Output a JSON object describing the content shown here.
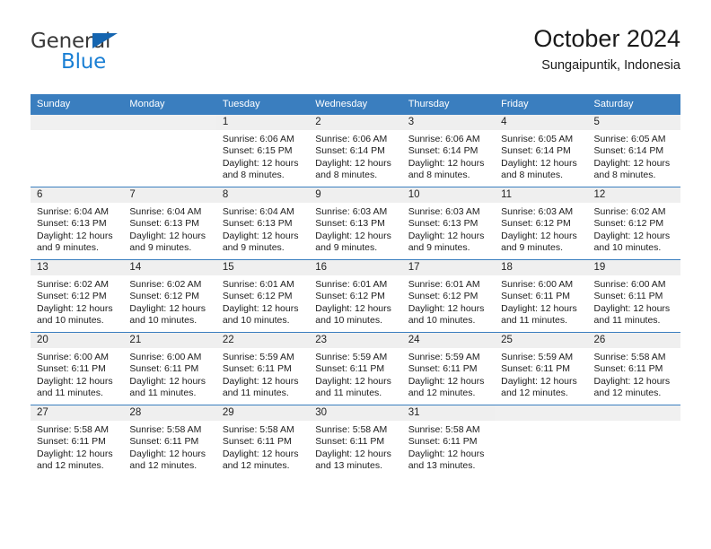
{
  "brand": {
    "name_top": "General",
    "name_bottom": "Blue",
    "accent_color": "#1a7fd4",
    "triangle_color": "#1565b0"
  },
  "header": {
    "title": "October 2024",
    "subtitle": "Sungaipuntik, Indonesia"
  },
  "theme": {
    "header_row_bg": "#3a7ebf",
    "daynum_bg": "#efefef",
    "row_divider": "#3a7ebf"
  },
  "weekdays": [
    "Sunday",
    "Monday",
    "Tuesday",
    "Wednesday",
    "Thursday",
    "Friday",
    "Saturday"
  ],
  "labels": {
    "sunrise_prefix": "Sunrise:",
    "sunset_prefix": "Sunset:",
    "daylight_prefix": "Daylight:"
  },
  "weeks": [
    [
      {
        "day": "",
        "lines": []
      },
      {
        "day": "",
        "lines": []
      },
      {
        "day": "1",
        "lines": [
          "Sunrise: 6:06 AM",
          "Sunset: 6:15 PM",
          "Daylight: 12 hours",
          "and 8 minutes."
        ]
      },
      {
        "day": "2",
        "lines": [
          "Sunrise: 6:06 AM",
          "Sunset: 6:14 PM",
          "Daylight: 12 hours",
          "and 8 minutes."
        ]
      },
      {
        "day": "3",
        "lines": [
          "Sunrise: 6:06 AM",
          "Sunset: 6:14 PM",
          "Daylight: 12 hours",
          "and 8 minutes."
        ]
      },
      {
        "day": "4",
        "lines": [
          "Sunrise: 6:05 AM",
          "Sunset: 6:14 PM",
          "Daylight: 12 hours",
          "and 8 minutes."
        ]
      },
      {
        "day": "5",
        "lines": [
          "Sunrise: 6:05 AM",
          "Sunset: 6:14 PM",
          "Daylight: 12 hours",
          "and 8 minutes."
        ]
      }
    ],
    [
      {
        "day": "6",
        "lines": [
          "Sunrise: 6:04 AM",
          "Sunset: 6:13 PM",
          "Daylight: 12 hours",
          "and 9 minutes."
        ]
      },
      {
        "day": "7",
        "lines": [
          "Sunrise: 6:04 AM",
          "Sunset: 6:13 PM",
          "Daylight: 12 hours",
          "and 9 minutes."
        ]
      },
      {
        "day": "8",
        "lines": [
          "Sunrise: 6:04 AM",
          "Sunset: 6:13 PM",
          "Daylight: 12 hours",
          "and 9 minutes."
        ]
      },
      {
        "day": "9",
        "lines": [
          "Sunrise: 6:03 AM",
          "Sunset: 6:13 PM",
          "Daylight: 12 hours",
          "and 9 minutes."
        ]
      },
      {
        "day": "10",
        "lines": [
          "Sunrise: 6:03 AM",
          "Sunset: 6:13 PM",
          "Daylight: 12 hours",
          "and 9 minutes."
        ]
      },
      {
        "day": "11",
        "lines": [
          "Sunrise: 6:03 AM",
          "Sunset: 6:12 PM",
          "Daylight: 12 hours",
          "and 9 minutes."
        ]
      },
      {
        "day": "12",
        "lines": [
          "Sunrise: 6:02 AM",
          "Sunset: 6:12 PM",
          "Daylight: 12 hours",
          "and 10 minutes."
        ]
      }
    ],
    [
      {
        "day": "13",
        "lines": [
          "Sunrise: 6:02 AM",
          "Sunset: 6:12 PM",
          "Daylight: 12 hours",
          "and 10 minutes."
        ]
      },
      {
        "day": "14",
        "lines": [
          "Sunrise: 6:02 AM",
          "Sunset: 6:12 PM",
          "Daylight: 12 hours",
          "and 10 minutes."
        ]
      },
      {
        "day": "15",
        "lines": [
          "Sunrise: 6:01 AM",
          "Sunset: 6:12 PM",
          "Daylight: 12 hours",
          "and 10 minutes."
        ]
      },
      {
        "day": "16",
        "lines": [
          "Sunrise: 6:01 AM",
          "Sunset: 6:12 PM",
          "Daylight: 12 hours",
          "and 10 minutes."
        ]
      },
      {
        "day": "17",
        "lines": [
          "Sunrise: 6:01 AM",
          "Sunset: 6:12 PM",
          "Daylight: 12 hours",
          "and 10 minutes."
        ]
      },
      {
        "day": "18",
        "lines": [
          "Sunrise: 6:00 AM",
          "Sunset: 6:11 PM",
          "Daylight: 12 hours",
          "and 11 minutes."
        ]
      },
      {
        "day": "19",
        "lines": [
          "Sunrise: 6:00 AM",
          "Sunset: 6:11 PM",
          "Daylight: 12 hours",
          "and 11 minutes."
        ]
      }
    ],
    [
      {
        "day": "20",
        "lines": [
          "Sunrise: 6:00 AM",
          "Sunset: 6:11 PM",
          "Daylight: 12 hours",
          "and 11 minutes."
        ]
      },
      {
        "day": "21",
        "lines": [
          "Sunrise: 6:00 AM",
          "Sunset: 6:11 PM",
          "Daylight: 12 hours",
          "and 11 minutes."
        ]
      },
      {
        "day": "22",
        "lines": [
          "Sunrise: 5:59 AM",
          "Sunset: 6:11 PM",
          "Daylight: 12 hours",
          "and 11 minutes."
        ]
      },
      {
        "day": "23",
        "lines": [
          "Sunrise: 5:59 AM",
          "Sunset: 6:11 PM",
          "Daylight: 12 hours",
          "and 11 minutes."
        ]
      },
      {
        "day": "24",
        "lines": [
          "Sunrise: 5:59 AM",
          "Sunset: 6:11 PM",
          "Daylight: 12 hours",
          "and 12 minutes."
        ]
      },
      {
        "day": "25",
        "lines": [
          "Sunrise: 5:59 AM",
          "Sunset: 6:11 PM",
          "Daylight: 12 hours",
          "and 12 minutes."
        ]
      },
      {
        "day": "26",
        "lines": [
          "Sunrise: 5:58 AM",
          "Sunset: 6:11 PM",
          "Daylight: 12 hours",
          "and 12 minutes."
        ]
      }
    ],
    [
      {
        "day": "27",
        "lines": [
          "Sunrise: 5:58 AM",
          "Sunset: 6:11 PM",
          "Daylight: 12 hours",
          "and 12 minutes."
        ]
      },
      {
        "day": "28",
        "lines": [
          "Sunrise: 5:58 AM",
          "Sunset: 6:11 PM",
          "Daylight: 12 hours",
          "and 12 minutes."
        ]
      },
      {
        "day": "29",
        "lines": [
          "Sunrise: 5:58 AM",
          "Sunset: 6:11 PM",
          "Daylight: 12 hours",
          "and 12 minutes."
        ]
      },
      {
        "day": "30",
        "lines": [
          "Sunrise: 5:58 AM",
          "Sunset: 6:11 PM",
          "Daylight: 12 hours",
          "and 13 minutes."
        ]
      },
      {
        "day": "31",
        "lines": [
          "Sunrise: 5:58 AM",
          "Sunset: 6:11 PM",
          "Daylight: 12 hours",
          "and 13 minutes."
        ]
      },
      {
        "day": "",
        "lines": []
      },
      {
        "day": "",
        "lines": []
      }
    ]
  ]
}
